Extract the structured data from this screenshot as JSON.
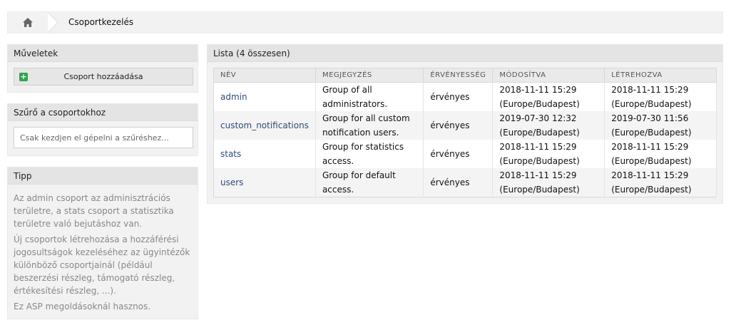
{
  "breadcrumb": {
    "current": "Csoportkezelés"
  },
  "actions": {
    "title": "Műveletek",
    "add_button": "Csoport hozzáadása"
  },
  "filter": {
    "title": "Szűrő a csoportokhoz",
    "placeholder": "Csak kezdjen el gépelni a szűréshez..."
  },
  "tip": {
    "title": "Tipp",
    "paragraphs": [
      "Az admin csoport az adminisztrációs területre, a stats csoport a statisztika területre való bejutáshoz van.",
      "Új csoportok létrehozása a hozzáférési jogosultságok kezeléséhez az ügyintézők különböző csoportjainál (például beszerzési részleg, támogató részleg, értékesítési részleg, ...).",
      "Ez ASP megoldásoknál hasznos."
    ]
  },
  "list": {
    "title": "Lista (4 összesen)",
    "columns": [
      "NÉV",
      "MEGJEGYZÉS",
      "ÉRVÉNYESSÉG",
      "MÓDOSÍTVA",
      "LÉTREHOZVA"
    ],
    "rows": [
      {
        "name": "admin",
        "comment": "Group of all administrators.",
        "validity": "érvényes",
        "modified": "2018-11-11 15:29 (Europe/Budapest)",
        "created": "2018-11-11 15:29 (Europe/Budapest)"
      },
      {
        "name": "custom_notifications",
        "comment": "Group for all custom notification users.",
        "validity": "érvényes",
        "modified": "2019-07-30 12:32 (Europe/Budapest)",
        "created": "2019-07-30 11:56 (Europe/Budapest)"
      },
      {
        "name": "stats",
        "comment": "Group for statistics access.",
        "validity": "érvényes",
        "modified": "2018-11-11 15:29 (Europe/Budapest)",
        "created": "2018-11-11 15:29 (Europe/Budapest)"
      },
      {
        "name": "users",
        "comment": "Group for default access.",
        "validity": "érvényes",
        "modified": "2018-11-11 15:29 (Europe/Budapest)",
        "created": "2018-11-11 15:29 (Europe/Budapest)"
      }
    ]
  },
  "icons": {
    "home": "home-icon",
    "add": "plus-icon"
  },
  "colors": {
    "link": "#2e4b7a",
    "add_icon": "#2da44e"
  }
}
